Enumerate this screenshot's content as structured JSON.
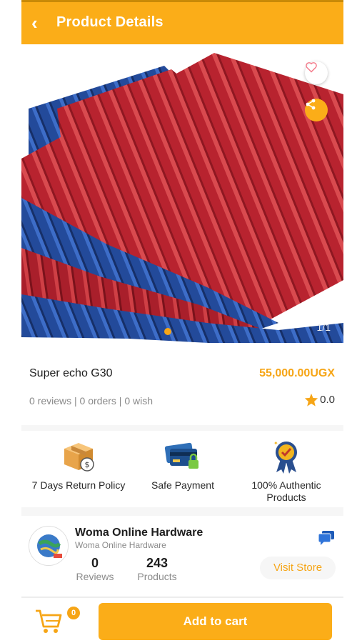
{
  "header": {
    "title": "Product Details",
    "back_icon": "back-arrow-icon"
  },
  "gallery": {
    "counter": "1/1",
    "favorite_icon": "heart-icon",
    "share_icon": "share-icon",
    "active_index": 1,
    "total": 1
  },
  "product": {
    "name": "Super echo G30",
    "price": "55,000.00UGX",
    "stats": "0 reviews | 0 orders | 0 wish",
    "rating": "0.0"
  },
  "features": [
    {
      "label": "7 Days Return Policy",
      "icon": "return-box-icon"
    },
    {
      "label": "Safe Payment",
      "icon": "secure-card-icon"
    },
    {
      "label": "100% Authentic Products",
      "icon": "authentic-badge-icon"
    }
  ],
  "store": {
    "name": "Woma Online Hardware",
    "subtitle": "Woma Online Hardware",
    "reviews_count": "0",
    "reviews_label": "Reviews",
    "products_count": "243",
    "products_label": "Products",
    "visit_label": "Visit Store",
    "chat_icon": "chat-icon"
  },
  "bottom_bar": {
    "cart_count": "0",
    "add_to_cart_label": "Add to cart",
    "cart_icon": "cart-icon"
  },
  "colors": {
    "accent": "#fbad18",
    "price": "#f6a516",
    "sheet_red": "#b8232f",
    "sheet_blue": "#234a9a"
  }
}
